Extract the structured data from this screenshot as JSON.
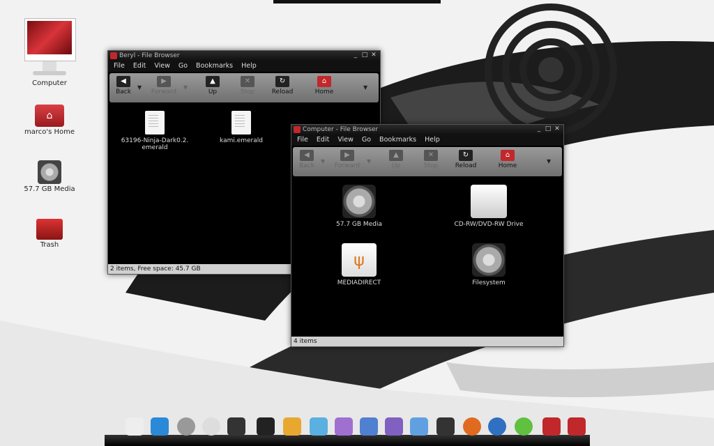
{
  "desktop": {
    "icons": [
      {
        "label": "Computer"
      },
      {
        "label": "marco's Home"
      },
      {
        "label": "57.7 GB Media"
      },
      {
        "label": "Trash"
      }
    ]
  },
  "window1": {
    "title": "Beryl - File Browser",
    "menu": [
      "File",
      "Edit",
      "View",
      "Go",
      "Bookmarks",
      "Help"
    ],
    "toolbar": {
      "back": "Back",
      "forward": "Forward",
      "up": "Up",
      "stop": "Stop",
      "reload": "Reload",
      "home": "Home"
    },
    "files": [
      {
        "label": "63196-Ninja-Dark0.2.\nemerald"
      },
      {
        "label": "kami.emerald"
      }
    ],
    "status": "2 items, Free space: 45.7 GB"
  },
  "window2": {
    "title": "Computer - File Browser",
    "menu": [
      "File",
      "Edit",
      "View",
      "Go",
      "Bookmarks",
      "Help"
    ],
    "toolbar": {
      "back": "Back",
      "forward": "Forward",
      "up": "Up",
      "stop": "Stop",
      "reload": "Reload",
      "home": "Home"
    },
    "items": [
      {
        "label": "57.7 GB Media",
        "icon": "hard-drive-icon"
      },
      {
        "label": "CD-RW/DVD-RW Drive",
        "icon": "optical-drive-icon"
      },
      {
        "label": "MEDIADIRECT",
        "icon": "usb-drive-icon"
      },
      {
        "label": "Filesystem",
        "icon": "hard-drive-icon"
      }
    ],
    "status": "4 items"
  },
  "colors": {
    "accent": "#c0282c",
    "window_bg": "#000000",
    "toolbar": "#8a8a8a"
  }
}
